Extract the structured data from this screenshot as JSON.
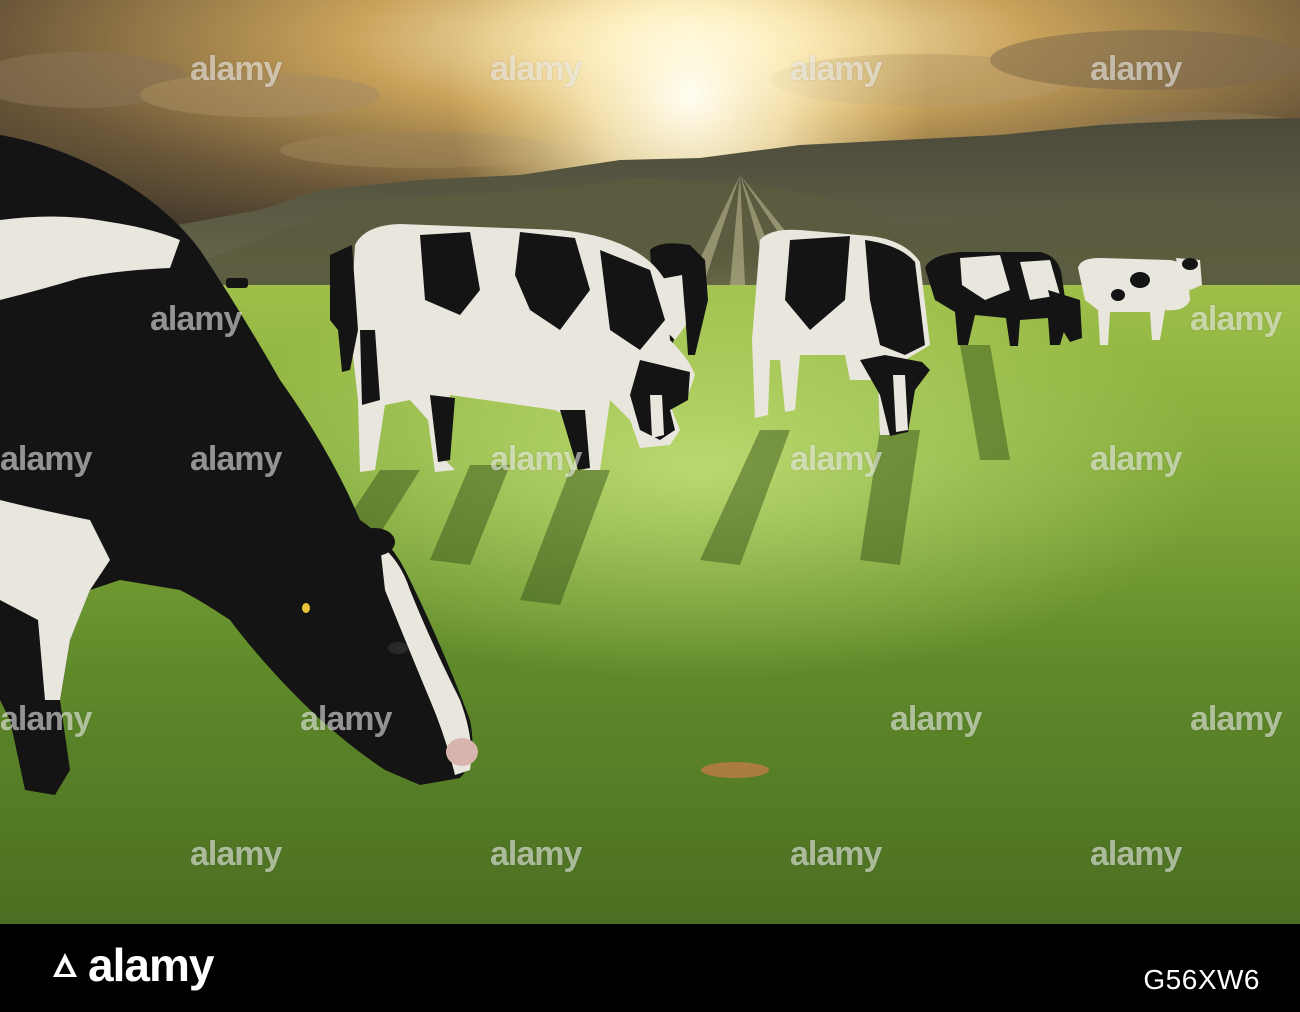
{
  "watermark": {
    "text": "alamy"
  },
  "footer": {
    "brand": "alamy",
    "image_id": "G56XW6"
  },
  "scene": {
    "subject": "grazing-cattle-icon",
    "sky_color": "#c9a25a",
    "sun_color": "#fff6d8",
    "grass_color": "#7fa83a",
    "cow_black": "#141414",
    "cow_white": "#e9e6de"
  }
}
